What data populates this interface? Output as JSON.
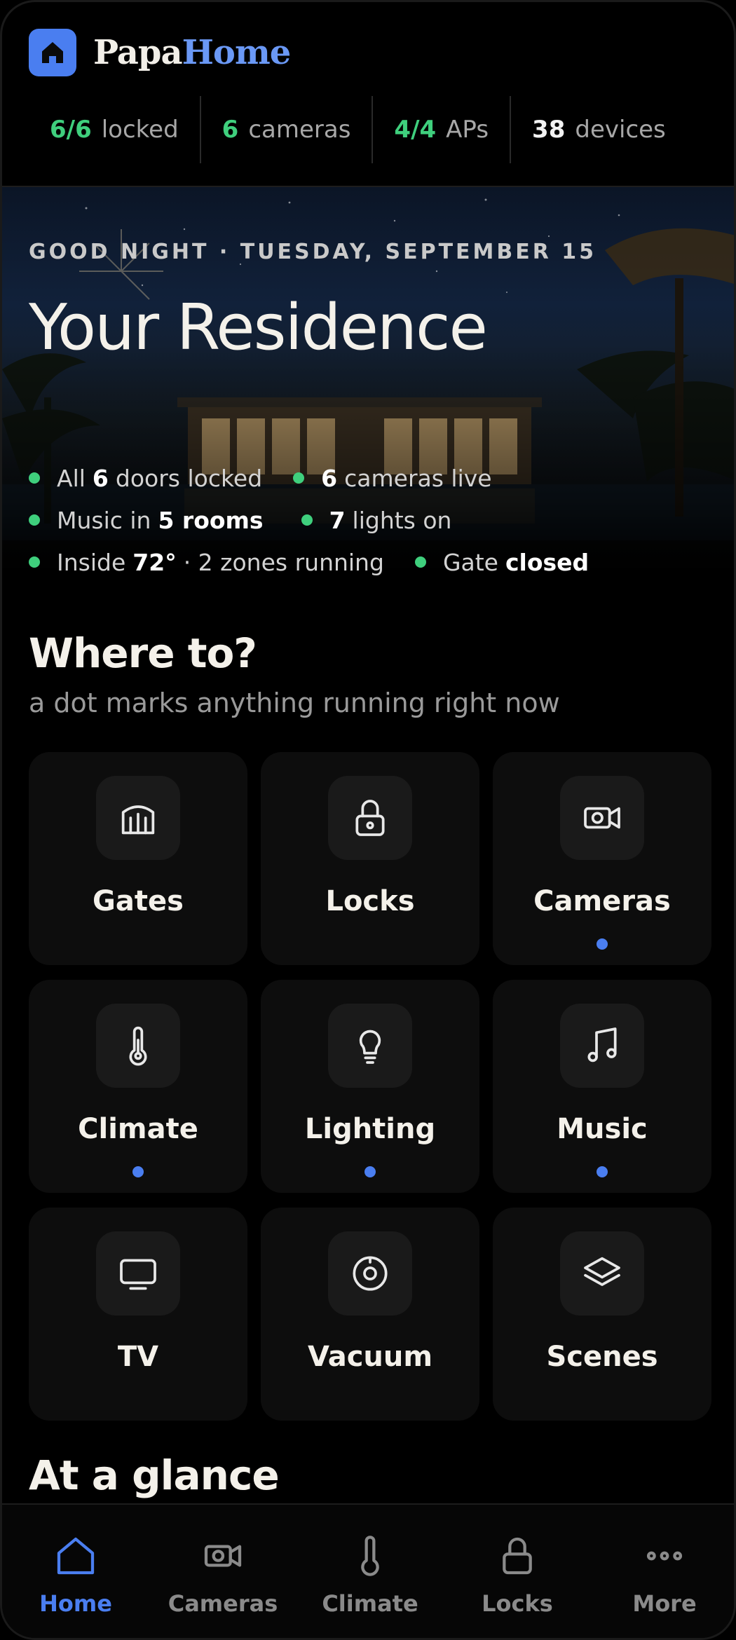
{
  "header": {
    "brand_part1": "Papa",
    "brand_part2": "Home",
    "stats": [
      {
        "value": "6/6",
        "label": "locked",
        "color": "#3fcf7d"
      },
      {
        "value": "6",
        "label": "cameras",
        "color": "#3fcf7d"
      },
      {
        "value": "4/4",
        "label": "APs",
        "color": "#3fcf7d"
      },
      {
        "value": "38",
        "label": "devices",
        "color": "#f2f2f2"
      }
    ]
  },
  "hero": {
    "greeting_date": "GOOD NIGHT · TUESDAY, SEPTEMBER 15",
    "title": "Your Residence",
    "status": [
      {
        "pre": "All",
        "bold": "6",
        "post": "doors locked"
      },
      {
        "pre": "",
        "bold": "6",
        "post": "cameras live"
      },
      {
        "pre": "Music in",
        "bold": "5 rooms",
        "post": ""
      },
      {
        "pre": "",
        "bold": "7",
        "post": "lights on"
      },
      {
        "pre": "Inside",
        "bold": "72°",
        "post": "· 2 zones running"
      },
      {
        "pre": "Gate",
        "bold": "closed",
        "post": ""
      }
    ]
  },
  "where_to": {
    "title": "Where to?",
    "subtitle": "a dot marks anything running right now",
    "tiles": [
      {
        "label": "Gates",
        "icon": "gate-icon",
        "active": false
      },
      {
        "label": "Locks",
        "icon": "lock-icon",
        "active": false
      },
      {
        "label": "Cameras",
        "icon": "camera-icon",
        "active": true
      },
      {
        "label": "Climate",
        "icon": "thermometer-icon",
        "active": true
      },
      {
        "label": "Lighting",
        "icon": "bulb-icon",
        "active": true
      },
      {
        "label": "Music",
        "icon": "music-note-icon",
        "active": true
      },
      {
        "label": "TV",
        "icon": "tv-icon",
        "active": false
      },
      {
        "label": "Vacuum",
        "icon": "vacuum-icon",
        "active": false
      },
      {
        "label": "Scenes",
        "icon": "layers-icon",
        "active": false
      }
    ]
  },
  "at_a_glance": {
    "title": "At a glance"
  },
  "nav": {
    "items": [
      {
        "label": "Home",
        "icon": "home-icon",
        "active": true
      },
      {
        "label": "Cameras",
        "icon": "camera-icon",
        "active": false
      },
      {
        "label": "Climate",
        "icon": "thermometer-icon",
        "active": false
      },
      {
        "label": "Locks",
        "icon": "lock-icon",
        "active": false
      },
      {
        "label": "More",
        "icon": "more-icon",
        "active": false
      }
    ]
  },
  "colors": {
    "accent": "#4a7ef0",
    "success": "#3fcf7d",
    "background": "#000000"
  }
}
